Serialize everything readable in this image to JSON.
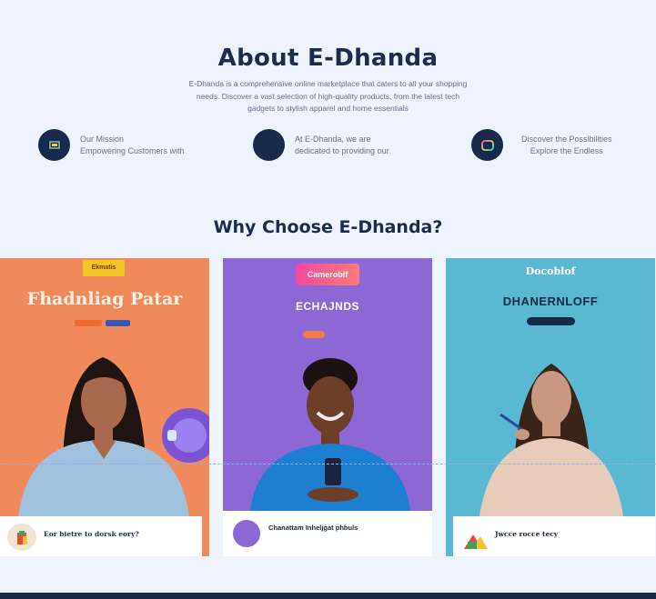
{
  "about": {
    "title": "About E-Dhanda",
    "intro": "E-Dhanda is a comprehensive online marketplace that caters to all your shopping needs. Discover a vast selection of high-quality products, from the latest tech gadgets to stylish apparel and home essentials"
  },
  "features": [
    {
      "line1": "Our Mission",
      "line2": "Empowering Customers with",
      "icon": "monitor-icon"
    },
    {
      "line1": "At E-Dhanda, we are",
      "line2": "dedicated to providing our",
      "icon": "circle-icon"
    },
    {
      "line1": "Discover the Possibilities",
      "line2": "Explore the Endless",
      "icon": "gradient-square-icon"
    }
  ],
  "why": {
    "title": "Why Choose E-Dhanda?"
  },
  "cards": [
    {
      "logo": "Ekmatis",
      "headline": "Fhadnliag Patar",
      "footer_title": "Eor bietre to dorsk eory?",
      "bg": "#f08a5d"
    },
    {
      "badge": "Camerobif",
      "headline": "ECHAJNDS",
      "footer_title": "Chanattam Inheljgat phbuls",
      "bg": "#8b68d3"
    },
    {
      "logo": "Docoblof",
      "headline": "DHANERNLOFF",
      "footer_title": "Jwcce rocce tecy",
      "bg": "#5ab8d2"
    }
  ]
}
